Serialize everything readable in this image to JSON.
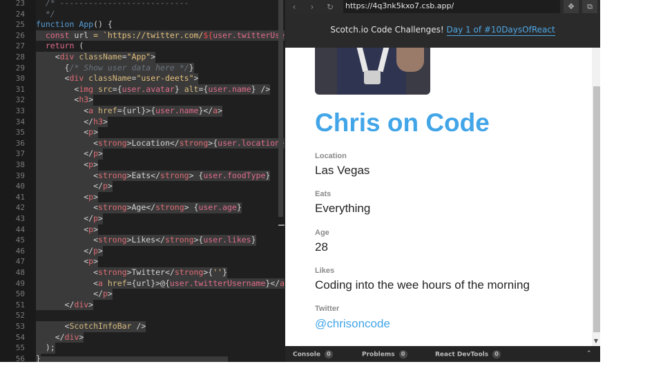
{
  "editor": {
    "lines": [
      {
        "n": "23",
        "segs": [
          {
            "t": "  /* ---------------------------",
            "c": "c-cmt"
          }
        ]
      },
      {
        "n": "24",
        "segs": [
          {
            "t": "  */",
            "c": "c-cmt"
          }
        ]
      },
      {
        "n": "25",
        "segs": [
          {
            "t": "function ",
            "c": "c-kw"
          },
          {
            "t": "App",
            "c": "c-kw"
          },
          {
            "t": "() {",
            "c": "c-txt"
          }
        ]
      },
      {
        "n": "26",
        "segs": [
          {
            "t": "  const ",
            "c": "c-pink"
          },
          {
            "t": "url",
            "c": "c-txt"
          },
          {
            "t": " = `https://twitter.com/",
            "c": "c-str"
          },
          {
            "t": "${",
            "c": "c-red"
          },
          {
            "t": "user.twitterUse",
            "c": "c-pink"
          }
        ]
      },
      {
        "n": "27",
        "segs": [
          {
            "t": "  return",
            "c": "c-pink"
          },
          {
            "t": " (",
            "c": "c-txt"
          }
        ]
      },
      {
        "n": "28",
        "segs": [
          {
            "t": "    <",
            "c": "c-txt"
          },
          {
            "t": "div",
            "c": "c-tag"
          },
          {
            "t": " className",
            "c": "c-attr"
          },
          {
            "t": "=",
            "c": "c-txt"
          },
          {
            "t": "\"App\"",
            "c": "c-str"
          },
          {
            "t": ">",
            "c": "c-txt"
          }
        ]
      },
      {
        "n": "29",
        "segs": [
          {
            "t": "      {",
            "c": "c-txt"
          },
          {
            "t": "/* Show user data here */",
            "c": "c-cmt"
          },
          {
            "t": "}",
            "c": "c-txt"
          }
        ]
      },
      {
        "n": "30",
        "segs": [
          {
            "t": "      <",
            "c": "c-txt"
          },
          {
            "t": "div",
            "c": "c-tag"
          },
          {
            "t": " className",
            "c": "c-attr"
          },
          {
            "t": "=",
            "c": "c-txt"
          },
          {
            "t": "\"user-deets\"",
            "c": "c-str"
          },
          {
            "t": ">",
            "c": "c-txt"
          }
        ]
      },
      {
        "n": "31",
        "segs": [
          {
            "t": "        <",
            "c": "c-txt"
          },
          {
            "t": "img",
            "c": "c-tag"
          },
          {
            "t": " src",
            "c": "c-attr"
          },
          {
            "t": "={",
            "c": "c-txt"
          },
          {
            "t": "user.avatar",
            "c": "c-pink"
          },
          {
            "t": "} ",
            "c": "c-txt"
          },
          {
            "t": "alt",
            "c": "c-attr"
          },
          {
            "t": "={",
            "c": "c-txt"
          },
          {
            "t": "user.name",
            "c": "c-pink"
          },
          {
            "t": "} />",
            "c": "c-txt"
          }
        ]
      },
      {
        "n": "32",
        "segs": [
          {
            "t": "        <",
            "c": "c-txt"
          },
          {
            "t": "h3",
            "c": "c-tag"
          },
          {
            "t": ">",
            "c": "c-txt"
          }
        ]
      },
      {
        "n": "33",
        "segs": [
          {
            "t": "          <",
            "c": "c-txt"
          },
          {
            "t": "a",
            "c": "c-tag"
          },
          {
            "t": " href",
            "c": "c-attr"
          },
          {
            "t": "={url}>{",
            "c": "c-txt"
          },
          {
            "t": "user.name",
            "c": "c-pink"
          },
          {
            "t": "}</",
            "c": "c-txt"
          },
          {
            "t": "a",
            "c": "c-tag"
          },
          {
            "t": ">",
            "c": "c-txt"
          }
        ]
      },
      {
        "n": "34",
        "segs": [
          {
            "t": "          </",
            "c": "c-txt"
          },
          {
            "t": "h3",
            "c": "c-tag"
          },
          {
            "t": ">",
            "c": "c-txt"
          }
        ]
      },
      {
        "n": "35",
        "segs": [
          {
            "t": "          <",
            "c": "c-txt"
          },
          {
            "t": "p",
            "c": "c-tag"
          },
          {
            "t": ">",
            "c": "c-txt"
          }
        ]
      },
      {
        "n": "36",
        "segs": [
          {
            "t": "            <",
            "c": "c-txt"
          },
          {
            "t": "strong",
            "c": "c-tag"
          },
          {
            "t": ">Location</",
            "c": "c-txt"
          },
          {
            "t": "strong",
            "c": "c-tag"
          },
          {
            "t": ">{",
            "c": "c-txt"
          },
          {
            "t": "user.location",
            "c": "c-pink"
          },
          {
            "t": "}",
            "c": "c-txt"
          }
        ]
      },
      {
        "n": "37",
        "segs": [
          {
            "t": "          </",
            "c": "c-txt"
          },
          {
            "t": "p",
            "c": "c-tag"
          },
          {
            "t": ">",
            "c": "c-txt"
          }
        ]
      },
      {
        "n": "38",
        "segs": [
          {
            "t": "          <",
            "c": "c-txt"
          },
          {
            "t": "p",
            "c": "c-tag"
          },
          {
            "t": ">",
            "c": "c-txt"
          }
        ]
      },
      {
        "n": "39",
        "segs": [
          {
            "t": "            <",
            "c": "c-txt"
          },
          {
            "t": "strong",
            "c": "c-tag"
          },
          {
            "t": ">Eats</",
            "c": "c-txt"
          },
          {
            "t": "strong",
            "c": "c-tag"
          },
          {
            "t": "> {",
            "c": "c-txt"
          },
          {
            "t": "user.foodType",
            "c": "c-pink"
          },
          {
            "t": "}",
            "c": "c-txt"
          }
        ]
      },
      {
        "n": "40",
        "segs": [
          {
            "t": "            </",
            "c": "c-txt"
          },
          {
            "t": "p",
            "c": "c-tag"
          },
          {
            "t": ">",
            "c": "c-txt"
          }
        ]
      },
      {
        "n": "41",
        "segs": [
          {
            "t": "          <",
            "c": "c-txt"
          },
          {
            "t": "p",
            "c": "c-tag"
          },
          {
            "t": ">",
            "c": "c-txt"
          }
        ]
      },
      {
        "n": "42",
        "segs": [
          {
            "t": "            <",
            "c": "c-txt"
          },
          {
            "t": "strong",
            "c": "c-tag"
          },
          {
            "t": ">Age</",
            "c": "c-txt"
          },
          {
            "t": "strong",
            "c": "c-tag"
          },
          {
            "t": "> {",
            "c": "c-txt"
          },
          {
            "t": "user.age",
            "c": "c-pink"
          },
          {
            "t": "}",
            "c": "c-txt"
          }
        ]
      },
      {
        "n": "43",
        "segs": [
          {
            "t": "          </",
            "c": "c-txt"
          },
          {
            "t": "p",
            "c": "c-tag"
          },
          {
            "t": ">",
            "c": "c-txt"
          }
        ]
      },
      {
        "n": "44",
        "segs": [
          {
            "t": "          <",
            "c": "c-txt"
          },
          {
            "t": "p",
            "c": "c-tag"
          },
          {
            "t": ">",
            "c": "c-txt"
          }
        ]
      },
      {
        "n": "45",
        "segs": [
          {
            "t": "            <",
            "c": "c-txt"
          },
          {
            "t": "strong",
            "c": "c-tag"
          },
          {
            "t": ">Likes</",
            "c": "c-txt"
          },
          {
            "t": "strong",
            "c": "c-tag"
          },
          {
            "t": ">{",
            "c": "c-txt"
          },
          {
            "t": "user.likes",
            "c": "c-pink"
          },
          {
            "t": "}",
            "c": "c-txt"
          }
        ]
      },
      {
        "n": "46",
        "segs": [
          {
            "t": "          </",
            "c": "c-txt"
          },
          {
            "t": "p",
            "c": "c-tag"
          },
          {
            "t": ">",
            "c": "c-txt"
          }
        ]
      },
      {
        "n": "47",
        "segs": [
          {
            "t": "          <",
            "c": "c-txt"
          },
          {
            "t": "p",
            "c": "c-tag"
          },
          {
            "t": ">",
            "c": "c-txt"
          }
        ]
      },
      {
        "n": "48",
        "segs": [
          {
            "t": "            <",
            "c": "c-txt"
          },
          {
            "t": "strong",
            "c": "c-tag"
          },
          {
            "t": ">Twitter</",
            "c": "c-txt"
          },
          {
            "t": "strong",
            "c": "c-tag"
          },
          {
            "t": ">{",
            "c": "c-txt"
          },
          {
            "t": "''",
            "c": "c-str"
          },
          {
            "t": "}",
            "c": "c-txt"
          }
        ]
      },
      {
        "n": "49",
        "segs": [
          {
            "t": "            <",
            "c": "c-txt"
          },
          {
            "t": "a",
            "c": "c-tag"
          },
          {
            "t": " href",
            "c": "c-attr"
          },
          {
            "t": "={url}>@{",
            "c": "c-txt"
          },
          {
            "t": "user.twitterUsername",
            "c": "c-pink"
          },
          {
            "t": "}</",
            "c": "c-txt"
          },
          {
            "t": "a",
            "c": "c-tag"
          }
        ]
      },
      {
        "n": "50",
        "segs": [
          {
            "t": "            </",
            "c": "c-txt"
          },
          {
            "t": "p",
            "c": "c-tag"
          },
          {
            "t": ">",
            "c": "c-txt"
          }
        ]
      },
      {
        "n": "51",
        "segs": [
          {
            "t": "      </",
            "c": "c-txt"
          },
          {
            "t": "div",
            "c": "c-tag"
          },
          {
            "t": ">",
            "c": "c-txt"
          }
        ]
      },
      {
        "n": "52",
        "segs": [
          {
            "t": "",
            "c": "c-txt"
          }
        ]
      },
      {
        "n": "53",
        "segs": [
          {
            "t": "      <",
            "c": "c-txt"
          },
          {
            "t": "ScotchInfoBar",
            "c": "c-attr"
          },
          {
            "t": " />",
            "c": "c-txt"
          }
        ]
      },
      {
        "n": "54",
        "segs": [
          {
            "t": "    </",
            "c": "c-txt"
          },
          {
            "t": "div",
            "c": "c-tag"
          },
          {
            "t": ">",
            "c": "c-txt"
          }
        ]
      },
      {
        "n": "55",
        "segs": [
          {
            "t": "  );",
            "c": "c-txt"
          }
        ]
      },
      {
        "n": "56",
        "segs": [
          {
            "t": "}",
            "c": "c-txt"
          }
        ]
      }
    ]
  },
  "browser": {
    "back_icon": "‹",
    "forward_icon": "›",
    "reload_icon": "↻",
    "url": "https://4q3nk5kxo7.csb.app/",
    "tool1_icon": "✥",
    "tool2_icon": "⧉",
    "banner_text": "Scotch.io Code Challenges!",
    "banner_link": "Day 1 of #10DaysOfReact"
  },
  "profile": {
    "name": "Chris on Code",
    "fields": [
      {
        "label": "Location",
        "value": "Las Vegas"
      },
      {
        "label": "Eats",
        "value": "Everything"
      },
      {
        "label": "Age",
        "value": "28"
      },
      {
        "label": "Likes",
        "value": "Coding into the wee hours of the morning"
      }
    ],
    "twitter_label": "Twitter",
    "twitter_value": "@chrisoncode"
  },
  "devtools": {
    "tabs": [
      {
        "label": "Console",
        "count": "0"
      },
      {
        "label": "Problems",
        "count": "0"
      },
      {
        "label": "React DevTools",
        "count": "0"
      }
    ],
    "toggle_icon": "⌃"
  },
  "colors": {
    "accent": "#42a5e8",
    "editor_bg": "#1f1f1f",
    "banner_bg": "#2a2a2a"
  }
}
